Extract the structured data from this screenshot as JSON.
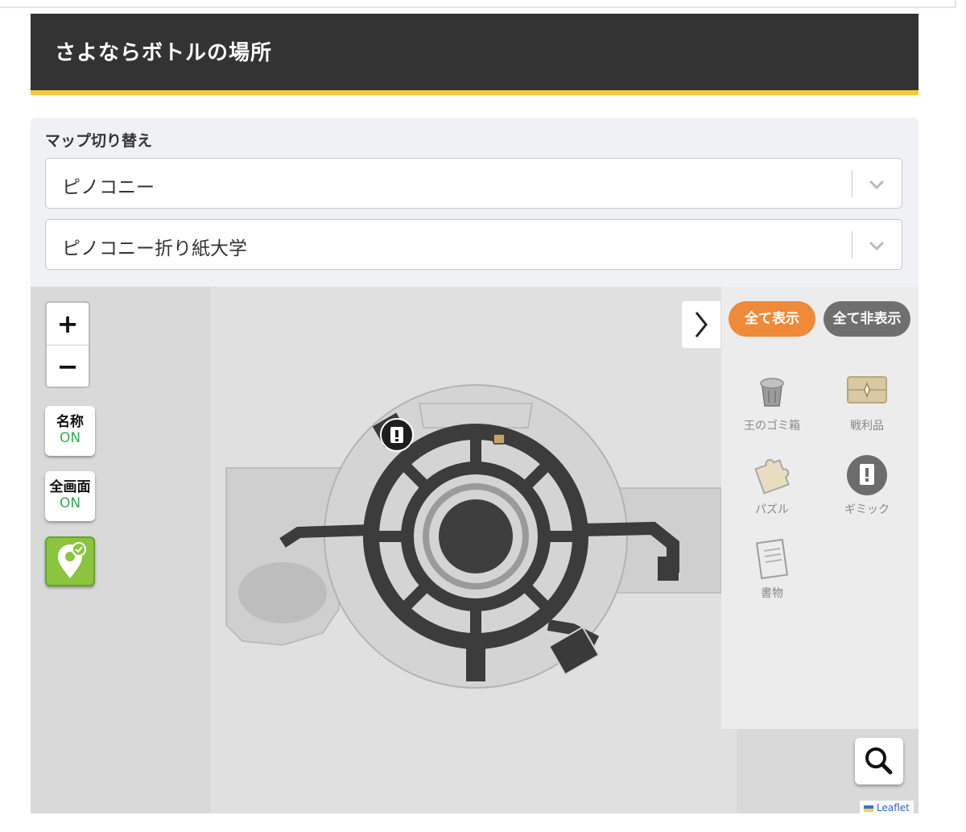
{
  "page": {
    "title": "さよならボトルの場所"
  },
  "map_switcher": {
    "label": "マップ切り替え",
    "world_select": "ピノコニー",
    "area_select": "ピノコニー折り紙大学"
  },
  "map_controls": {
    "zoom_in": "+",
    "zoom_out": "−",
    "names_toggle": {
      "label": "名称",
      "state": "ON"
    },
    "fullscreen_toggle": {
      "label": "全画面",
      "state": "ON"
    },
    "collect_icon": "map-pin-check-icon"
  },
  "filter_panel": {
    "show_all": "全て表示",
    "hide_all": "全て非表示",
    "categories": [
      {
        "label": "王のゴミ箱",
        "icon": "trash-can-icon"
      },
      {
        "label": "戦利品",
        "icon": "treasure-chest-icon"
      },
      {
        "label": "パズル",
        "icon": "puzzle-icon"
      },
      {
        "label": "ギミック",
        "icon": "gimmick-icon"
      },
      {
        "label": "書物",
        "icon": "book-icon"
      }
    ]
  },
  "attribution": "Leaflet",
  "colors": {
    "header_bg": "#333333",
    "header_accent": "#f3c93b",
    "show_all_bg": "#ef8a3a",
    "hide_all_bg": "#6f6f6f",
    "toggle_on": "#3aa858",
    "collect_bg": "#8bc43f"
  }
}
